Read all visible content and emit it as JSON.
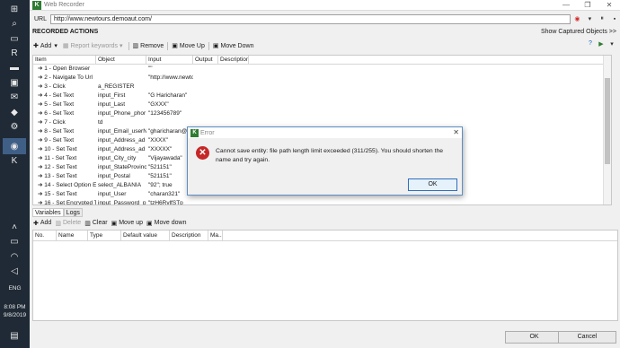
{
  "window": {
    "title": "Web Recorder",
    "controls": [
      "—",
      "❐",
      "✕"
    ]
  },
  "url": {
    "label": "URL",
    "value": "http://www.newtours.demoaut.com/"
  },
  "recorded_actions": {
    "heading": "RECORDED ACTIONS",
    "show_captured": "Show Captured Objects >>",
    "toolbar": {
      "add": "Add",
      "report_keywords": "Report keywords",
      "remove": "Remove",
      "move_up": "Move Up",
      "move_down": "Move Down"
    },
    "columns": [
      "Item",
      "Object",
      "Input",
      "Output",
      "Description"
    ],
    "rows": [
      [
        "1 - Open Browser",
        "",
        "\"\"",
        "",
        ""
      ],
      [
        "2 - Navigate To Url",
        "",
        "\"http://www.newto",
        "",
        ""
      ],
      [
        "3 - Click",
        "a_REGISTER",
        "",
        "",
        ""
      ],
      [
        "4 - Set Text",
        "input_First",
        "\"G Haricharan\"",
        "",
        ""
      ],
      [
        "5 - Set Text",
        "input_Last",
        "\"GXXX\"",
        "",
        ""
      ],
      [
        "6 - Set Text",
        "input_Phone_phor",
        "\"123456789\"",
        "",
        ""
      ],
      [
        "7 - Click",
        "td",
        "",
        "",
        ""
      ],
      [
        "8 - Set Text",
        "input_Email_userN",
        "\"gharicharan@g",
        "",
        ""
      ],
      [
        "9 - Set Text",
        "input_Address_ad",
        "\"XXXX\"",
        "",
        ""
      ],
      [
        "10 - Set Text",
        "input_Address_ad",
        "\"XXXXX\"",
        "",
        ""
      ],
      [
        "11 - Set Text",
        "input_City_city",
        "\"Vijayawada\"",
        "",
        ""
      ],
      [
        "12 - Set Text",
        "input_StateProvinc",
        "\"521151\"",
        "",
        ""
      ],
      [
        "13 - Set Text",
        "input_Postal",
        "\"521151\"",
        "",
        ""
      ],
      [
        "14 - Select Option E",
        "select_ALBANIA",
        "\"92\"; true",
        "",
        ""
      ],
      [
        "15 - Set Text",
        "input_User",
        "\"charan321\"",
        "",
        ""
      ],
      [
        "16 - Set Encrypted T",
        "input_Password_p",
        "\"tzH6RvlfSTp",
        "",
        ""
      ]
    ]
  },
  "bottom_tabs": [
    "Variables",
    "Logs"
  ],
  "variables": {
    "toolbar": {
      "add": "Add",
      "delete": "Delete",
      "clear": "Clear",
      "move_up": "Move up",
      "move_down": "Move down"
    },
    "columns": [
      "No.",
      "Name",
      "Type",
      "Default value",
      "Description",
      "Ma..."
    ]
  },
  "footer": {
    "ok": "OK",
    "cancel": "Cancel"
  },
  "dialog": {
    "title": "Error",
    "message": "Cannot save entity: file path length limit exceeded (311/255). You should shorten the name and try again.",
    "ok": "OK"
  },
  "taskbar": {
    "language": "ENG",
    "time": "8:08 PM",
    "date": "9/8/2019"
  }
}
